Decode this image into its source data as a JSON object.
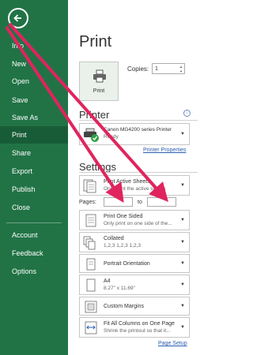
{
  "sidebar": {
    "items": [
      {
        "label": "Info"
      },
      {
        "label": "New"
      },
      {
        "label": "Open"
      },
      {
        "label": "Save"
      },
      {
        "label": "Save As"
      },
      {
        "label": "Print",
        "active": true
      },
      {
        "label": "Share"
      },
      {
        "label": "Export"
      },
      {
        "label": "Publish"
      },
      {
        "label": "Close"
      },
      {
        "label": "Account"
      },
      {
        "label": "Feedback"
      },
      {
        "label": "Options"
      }
    ],
    "back_icon": "back-arrow-icon"
  },
  "main": {
    "title": "Print",
    "print_button": "Print",
    "copies_label": "Copies:",
    "copies_value": "1",
    "printer": {
      "heading": "Printer",
      "name": "Canon MG4200 series Printer",
      "status": "Ready",
      "properties_link": "Printer Properties"
    },
    "settings": {
      "heading": "Settings",
      "what": {
        "title": "Print Active Sheets",
        "sub": "Only print the active sheets"
      },
      "pages_label": "Pages:",
      "to_label": "to",
      "sides": {
        "title": "Print One Sided",
        "sub": "Only print on one side of the..."
      },
      "collate": {
        "title": "Collated",
        "sub": "1,2,3    1,2,3    1,2,3"
      },
      "orientation": {
        "title": "Portrait Orientation"
      },
      "paper": {
        "title": "A4",
        "sub": "8.27\" x 11.69\""
      },
      "margins": {
        "title": "Custom Margins"
      },
      "scaling": {
        "title": "Fit All Columns on One Page",
        "sub": "Shrink the printout so that it..."
      },
      "page_setup_link": "Page Setup"
    }
  },
  "colors": {
    "sidebar": "#217346",
    "annotation_arrows": "#e0245e",
    "link": "#2a5db0"
  }
}
